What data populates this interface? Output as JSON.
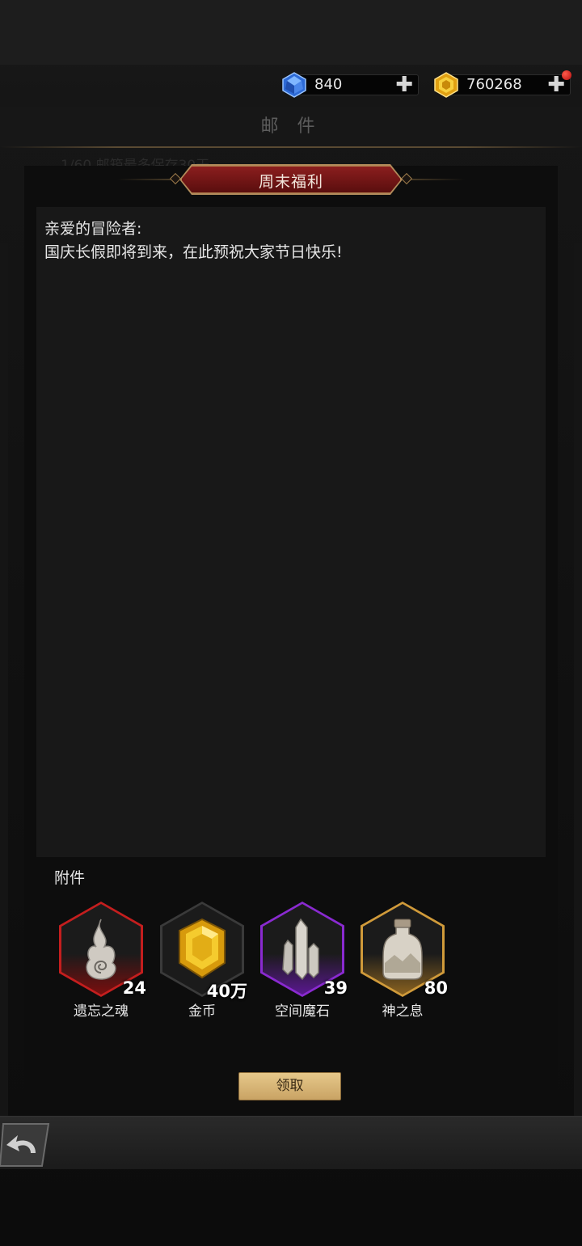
{
  "currency": {
    "gems": "840",
    "gold": "760268",
    "plus_symbol": "✚",
    "gem_color": "#3a7be0",
    "gold_color": "#e8b21a"
  },
  "page_title": "邮 件",
  "background_hint": "1/60 邮箱最多保存30天",
  "mail": {
    "title": "周末福利",
    "greeting": "亲爱的冒险者:",
    "body": "国庆长假即将到来，在此预祝大家节日快乐!"
  },
  "attachments": {
    "label": "附件",
    "items": [
      {
        "name": "遗忘之魂",
        "qty": "24",
        "icon": "soul-flame-icon",
        "frame_color": "#c41e1e"
      },
      {
        "name": "金币",
        "qty": "40万",
        "icon": "gold-coin-gem-icon",
        "frame_color": "#3a3a3a"
      },
      {
        "name": "空间魔石",
        "qty": "39",
        "icon": "crystal-cluster-icon",
        "frame_color": "#8a2ad0"
      },
      {
        "name": "神之息",
        "qty": "80",
        "icon": "potion-jar-icon",
        "frame_color": "#d09a3a"
      }
    ]
  },
  "claim_button": "领取"
}
